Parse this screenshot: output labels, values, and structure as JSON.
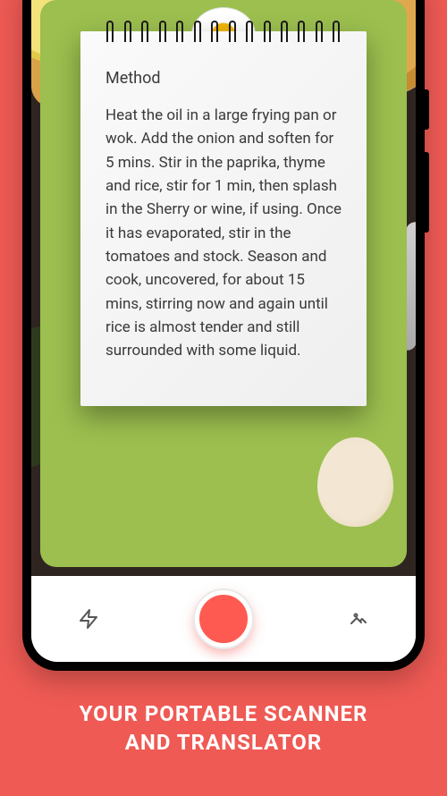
{
  "colors": {
    "background": "#ef5a54",
    "shutter": "#ff5a52"
  },
  "note": {
    "title": "Method",
    "body": "Heat the oil in a large frying pan or wok. Add the onion and soften for 5 mins. Stir in the paprika, thyme and rice, stir for 1 min, then splash in the Sherry or wine, if using. Once it has evaporated, stir in the tomatoes and stock. Season and cook, uncovered, for about 15 mins, stirring now and again until rice is almost tender and still surrounded with some liquid."
  },
  "controls": {
    "flash_icon": "flash-icon",
    "shutter_icon": "shutter-button",
    "gallery_icon": "gallery-icon"
  },
  "marketing": {
    "line1": "YOUR PORTABLE SCANNER",
    "line2": "AND TRANSLATOR"
  }
}
